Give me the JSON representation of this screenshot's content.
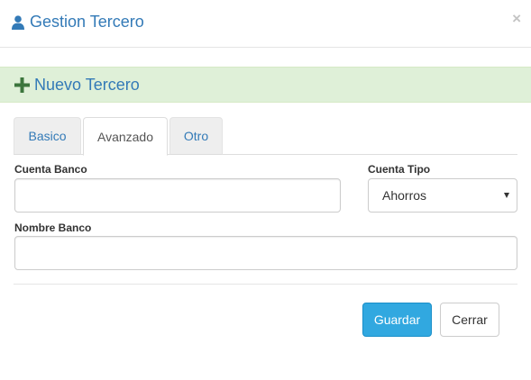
{
  "header": {
    "title": "Gestion Tercero",
    "close_symbol": "×",
    "icon": "user-icon"
  },
  "panel": {
    "title": "Nuevo Tercero",
    "icon": "plus-icon",
    "accent": "#dff0d8"
  },
  "tabs": [
    {
      "label": "Basico",
      "active": false
    },
    {
      "label": "Avanzado",
      "active": true
    },
    {
      "label": "Otro",
      "active": false
    }
  ],
  "form": {
    "cuenta_banco": {
      "label": "Cuenta Banco",
      "value": ""
    },
    "cuenta_tipo": {
      "label": "Cuenta Tipo",
      "value": "Ahorros"
    },
    "nombre_banco": {
      "label": "Nombre Banco",
      "value": ""
    }
  },
  "footer": {
    "save_label": "Guardar",
    "close_label": "Cerrar",
    "primary_color": "#31a8e0"
  }
}
